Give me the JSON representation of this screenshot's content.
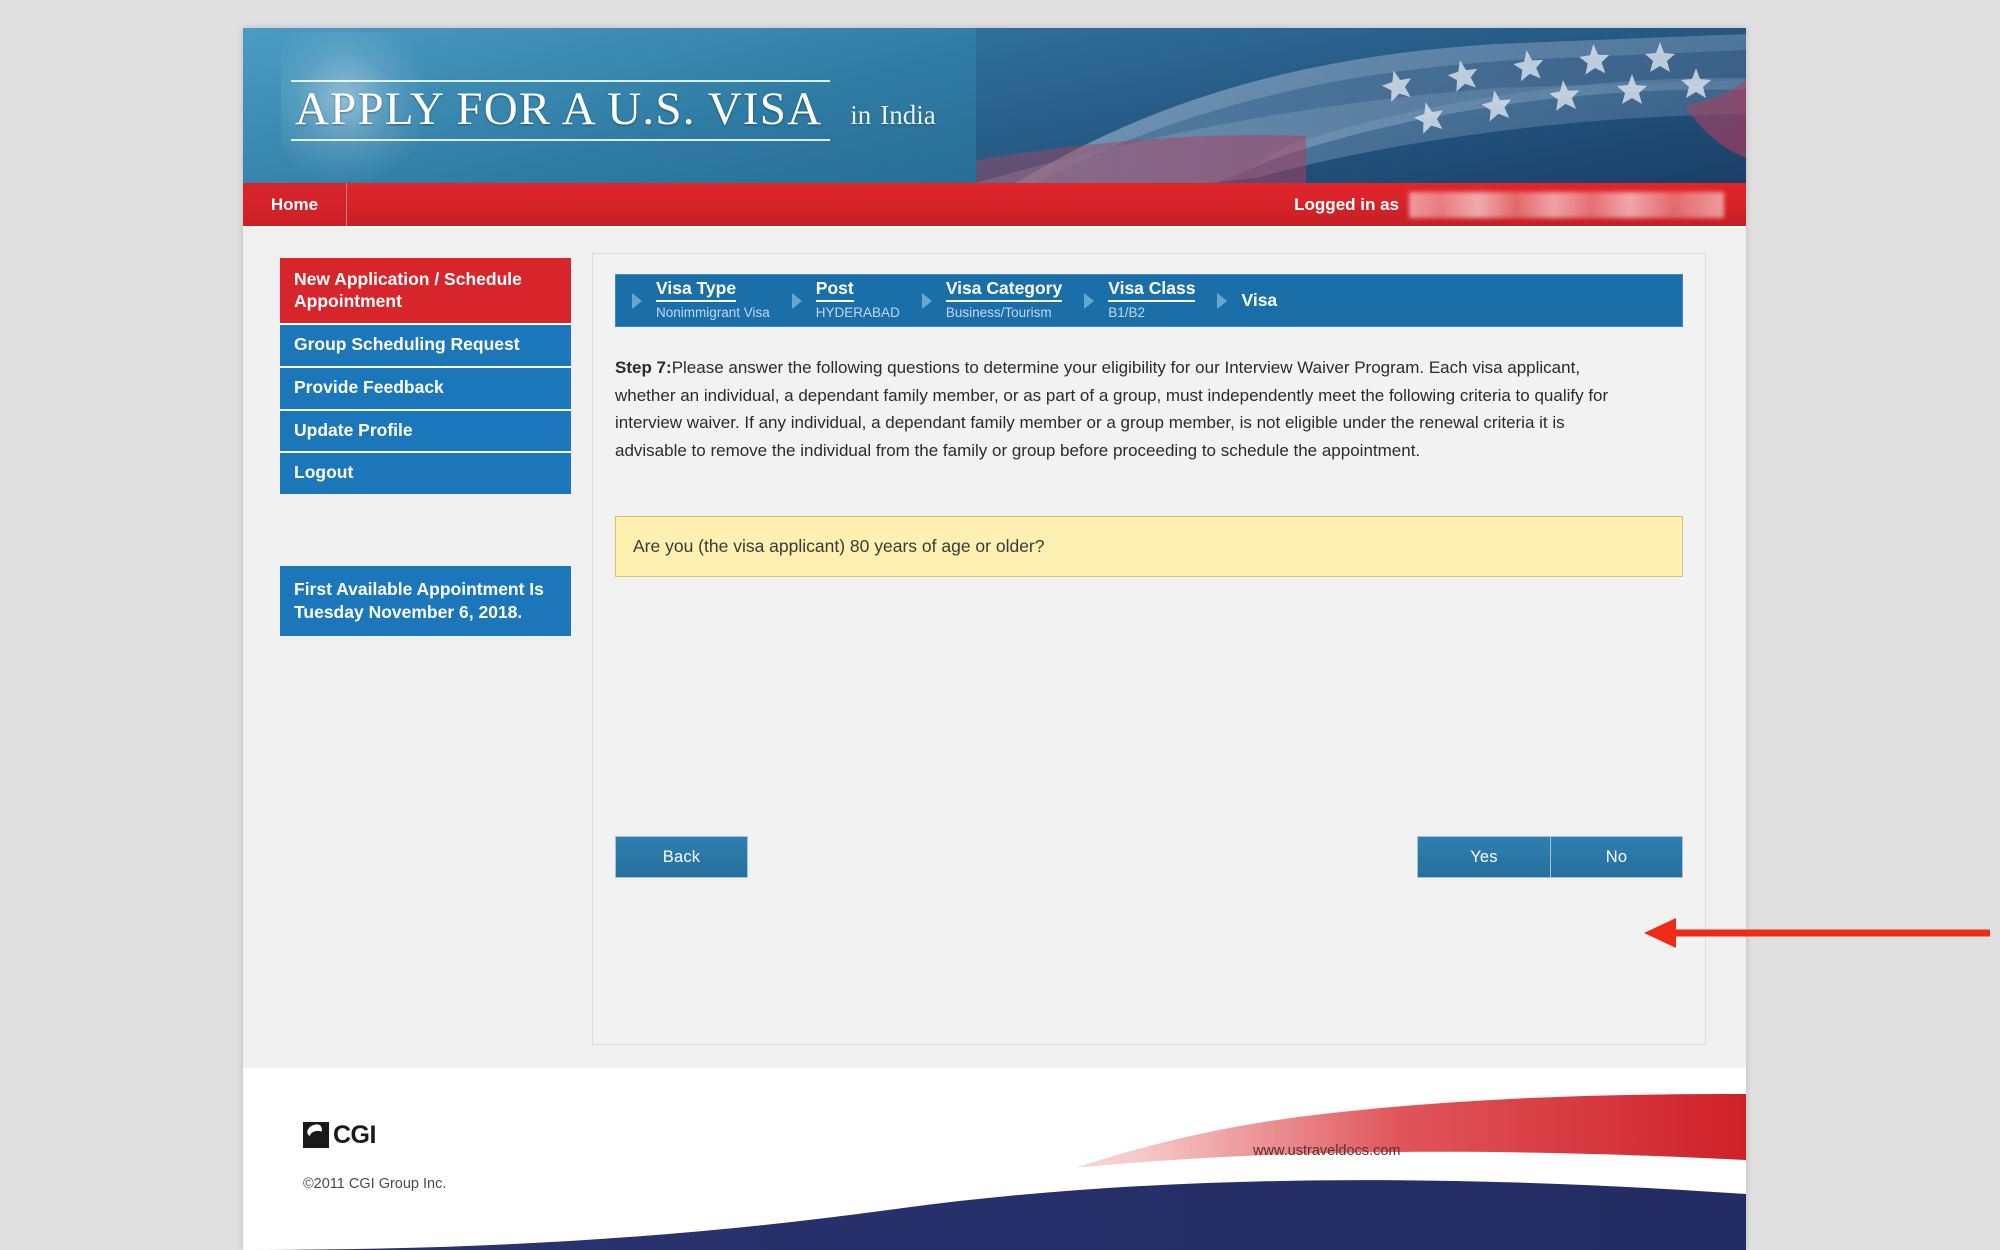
{
  "banner": {
    "title": "APPLY FOR A U.S. VISA",
    "in_word": "in",
    "country": "India"
  },
  "navbar": {
    "home_label": "Home",
    "logged_in_label": "Logged in as",
    "logged_in_user": ""
  },
  "sidebar": {
    "menu": [
      {
        "label": "New Application / Schedule Appointment",
        "active": true
      },
      {
        "label": "Group Scheduling Request",
        "active": false
      },
      {
        "label": "Provide Feedback",
        "active": false
      },
      {
        "label": "Update Profile",
        "active": false
      },
      {
        "label": "Logout",
        "active": false
      }
    ],
    "appointment_notice": "First Available Appointment Is Tuesday November 6, 2018."
  },
  "breadcrumb": [
    {
      "title": "Visa Type",
      "sub": "Nonimmigrant Visa",
      "current": false
    },
    {
      "title": "Post",
      "sub": "HYDERABAD",
      "current": false
    },
    {
      "title": "Visa Category",
      "sub": "Business/Tourism",
      "current": false
    },
    {
      "title": "Visa Class",
      "sub": "B1/B2",
      "current": false
    },
    {
      "title": "Visa",
      "sub": "",
      "current": true
    }
  ],
  "main": {
    "step_label": "Step 7:",
    "step_body": "Please answer the following questions to determine your eligibility for our Interview Waiver Program. Each visa applicant, whether an individual, a dependant family member, or as part of a group, must independently meet the following criteria to qualify for interview waiver. If any individual, a dependant family member or a group member, is not eligible under the renewal criteria it is advisable to remove the individual from the family or group before proceeding to schedule the appointment.",
    "question": "Are you (the visa applicant) 80 years of age or older?",
    "buttons": {
      "back": "Back",
      "yes": "Yes",
      "no": "No"
    }
  },
  "footer": {
    "logo_text": "CGI",
    "copyright": "©2011 CGI Group Inc.",
    "url": "www.ustraveldocs.com"
  },
  "colors": {
    "red": "#d8252c",
    "blue": "#1b77ba",
    "panel_blue": "#1b6fa8",
    "button_blue": "#2e7fb0",
    "question_yellow": "#fdf0b0",
    "annotation_red": "#ee2b16",
    "footer_navy": "#27316e"
  }
}
